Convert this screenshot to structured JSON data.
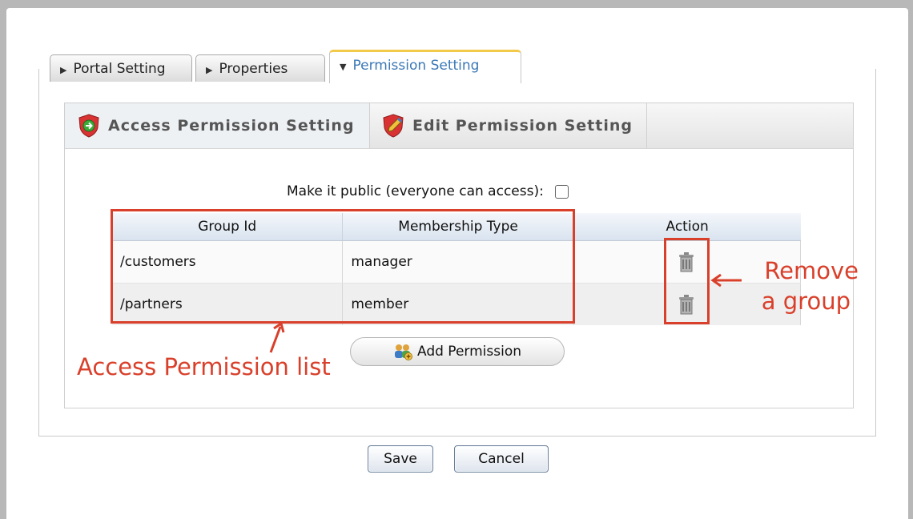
{
  "tabs": [
    {
      "label": "Portal Setting",
      "active": false
    },
    {
      "label": "Properties",
      "active": false
    },
    {
      "label": "Permission Setting",
      "active": true
    }
  ],
  "subtabs": [
    {
      "label": "Access Permission Setting",
      "active": true,
      "icon": "shield-arrow-icon"
    },
    {
      "label": "Edit Permission Setting",
      "active": false,
      "icon": "shield-pencil-icon"
    }
  ],
  "public_access": {
    "label": "Make it public (everyone can access):",
    "checked": false
  },
  "table": {
    "headers": [
      "Group Id",
      "Membership Type",
      "Action"
    ],
    "rows": [
      {
        "group": "/customers",
        "membership": "manager"
      },
      {
        "group": "/partners",
        "membership": "member"
      }
    ]
  },
  "add_permission_label": "Add Permission",
  "buttons": {
    "save": "Save",
    "cancel": "Cancel"
  },
  "annotations": {
    "list_label": "Access Permission list",
    "remove_line1": "Remove",
    "remove_line2": "a group",
    "color": "#d9402b"
  }
}
